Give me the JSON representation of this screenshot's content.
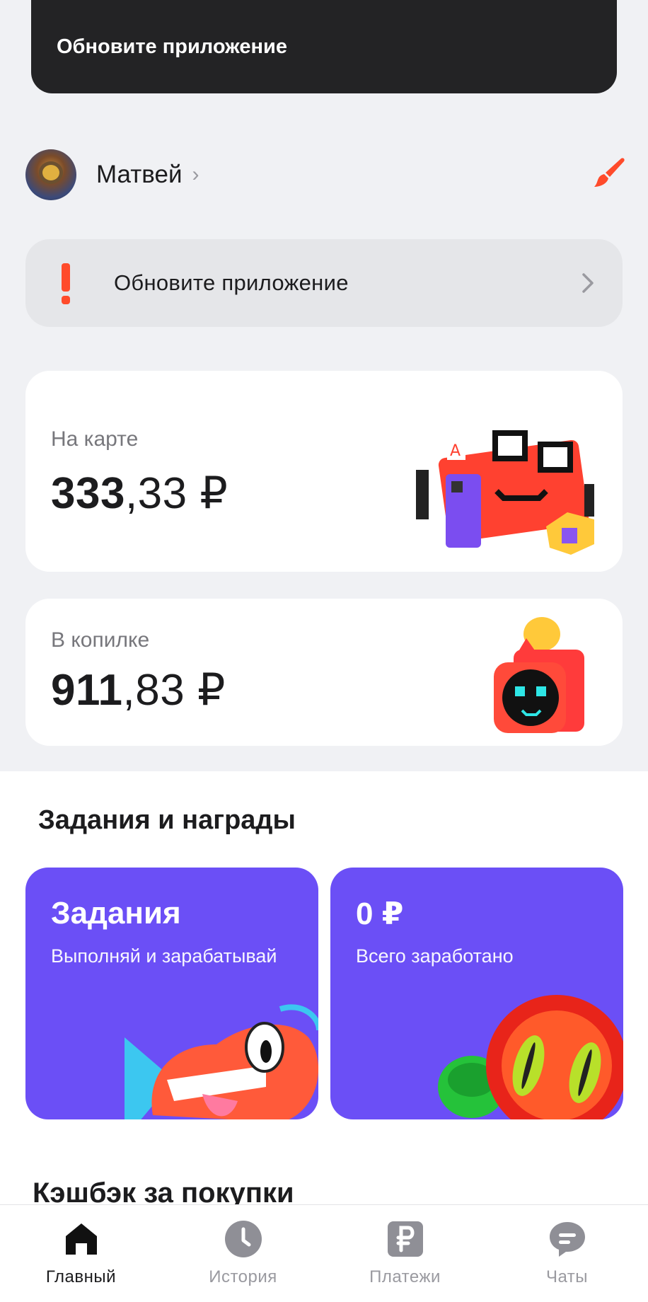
{
  "toast": {
    "text": "Обновите приложение"
  },
  "profile": {
    "name": "Матвей",
    "chevron": "›",
    "edit_icon": "brush-icon"
  },
  "update_banner": {
    "icon": "exclamation-icon",
    "text": "Обновите приложение",
    "chevron_icon": "chevron-right-icon"
  },
  "card_balance": {
    "label": "На карте",
    "value_int": "333",
    "value_frac": ",33 ₽"
  },
  "piggy_balance": {
    "label": "В копилке",
    "value_int": "911",
    "value_frac": ",83 ₽"
  },
  "rewards": {
    "title": "Задания и награды",
    "tasks": {
      "title": "Задания",
      "subtitle": "Выполняй и зарабатывай"
    },
    "earned": {
      "title": "0 ₽",
      "subtitle": "Всего заработано"
    }
  },
  "cashback": {
    "title": "Кэшбэк за покупки"
  },
  "tabbar": {
    "items": [
      {
        "label": "Главный",
        "icon": "home-icon",
        "active": true
      },
      {
        "label": "История",
        "icon": "clock-icon",
        "active": false
      },
      {
        "label": "Платежи",
        "icon": "ruble-icon",
        "active": false
      },
      {
        "label": "Чаты",
        "icon": "chat-icon",
        "active": false
      }
    ]
  },
  "colors": {
    "accent_purple": "#6b4ff6",
    "alert_red": "#ff4b2b",
    "toast_bg": "#232325"
  }
}
